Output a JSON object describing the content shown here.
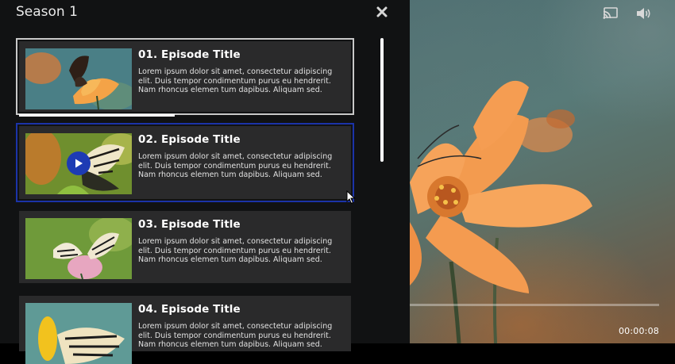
{
  "panel": {
    "season_title": "Season 1"
  },
  "episodes": [
    {
      "title": "01. Episode Title",
      "description": "Lorem ipsum dolor sit amet, consectetur adipiscing elit. Duis tempor condimentum purus eu hendrerit. Nam rhoncus elemen tum dapibus. Aliquam sed.",
      "state": "selected",
      "watched_fraction": 0.47
    },
    {
      "title": "02. Episode Title",
      "description": "Lorem ipsum dolor sit amet, consectetur adipiscing elit. Duis tempor condimentum purus eu hendrerit. Nam rhoncus elemen tum dapibus. Aliquam sed.",
      "state": "focused"
    },
    {
      "title": "03. Episode Title",
      "description": "Lorem ipsum dolor sit amet, consectetur adipiscing elit. Duis tempor condimentum purus eu hendrerit. Nam rhoncus elemen tum dapibus. Aliquam sed."
    },
    {
      "title": "04. Episode Title",
      "description": "Lorem ipsum dolor sit amet, consectetur adipiscing elit. Duis tempor condimentum purus eu hendrerit. Nam rhoncus elemen tum dapibus. Aliquam sed."
    }
  ],
  "player": {
    "time": "00:00:08"
  },
  "icons": {
    "close": "close-icon",
    "cast": "cast-icon",
    "volume": "volume-icon",
    "play": "play-icon"
  },
  "colors": {
    "panel_bg": "#111213",
    "card_bg": "#2a2a2b",
    "focus_border": "#1b33a8",
    "selected_border": "#c8c8c8",
    "play_button": "#1d3bb4"
  }
}
